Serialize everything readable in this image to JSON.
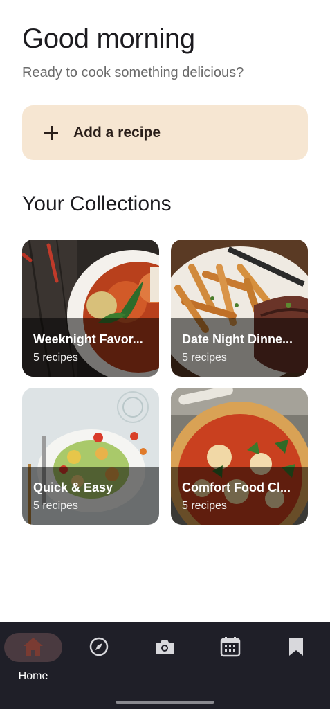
{
  "header": {
    "greeting": "Good morning",
    "subtitle": "Ready to cook something delicious?"
  },
  "add_recipe": {
    "label": "Add a recipe",
    "icon": "plus-icon",
    "background": "#f6e6d2"
  },
  "collections": {
    "title": "Your Collections",
    "items": [
      {
        "title": "Weeknight Favor...",
        "count": "5 recipes",
        "image": "curry-soup-bowl"
      },
      {
        "title": "Date Night Dinne...",
        "count": "5 recipes",
        "image": "steak-and-fries"
      },
      {
        "title": "Quick & Easy",
        "count": "5 recipes",
        "image": "caesar-salad"
      },
      {
        "title": "Comfort Food Cl...",
        "count": "5 recipes",
        "image": "margherita-pizza"
      }
    ]
  },
  "bottom_nav": {
    "items": [
      {
        "label": "Home",
        "icon": "home-icon",
        "active": true
      },
      {
        "label": "",
        "icon": "compass-icon",
        "active": false
      },
      {
        "label": "",
        "icon": "camera-icon",
        "active": false
      },
      {
        "label": "",
        "icon": "calendar-icon",
        "active": false
      },
      {
        "label": "",
        "icon": "bookmark-icon",
        "active": false
      }
    ],
    "active_color": "#7a3b32",
    "background": "#1f1f28"
  }
}
